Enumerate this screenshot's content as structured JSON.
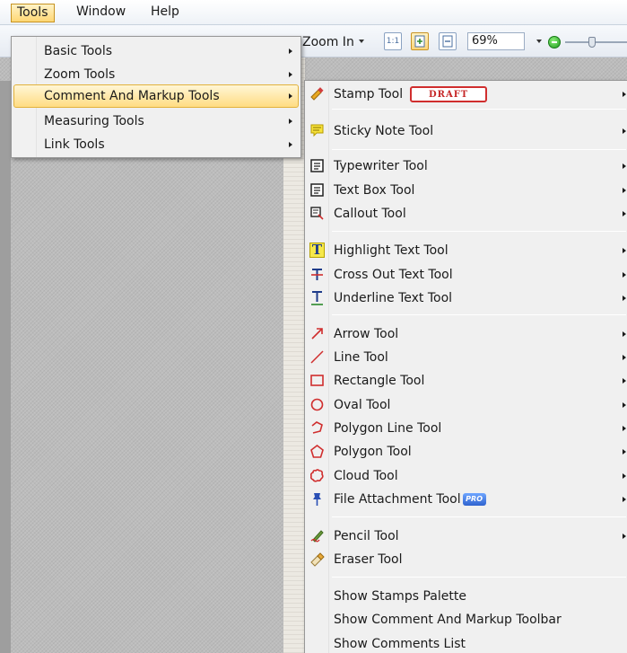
{
  "menubar": {
    "items": [
      {
        "label": "Tools",
        "active": true
      },
      {
        "label": "Window",
        "active": false
      },
      {
        "label": "Help",
        "active": false
      }
    ]
  },
  "toolbar": {
    "zoom_in_label": "Zoom In",
    "zoom_value": "69%",
    "actual_size_label": "1:1"
  },
  "tools_menu": {
    "items": [
      {
        "label": "Basic Tools",
        "highlighted": false
      },
      {
        "label": "Zoom Tools",
        "highlighted": false
      },
      {
        "label": "Comment And Markup Tools",
        "highlighted": true
      },
      {
        "label": "Measuring Tools",
        "highlighted": false
      },
      {
        "label": "Link Tools",
        "highlighted": false
      }
    ]
  },
  "markup_menu": {
    "items": [
      {
        "label": "Stamp Tool",
        "icon": "stamp-icon",
        "submenu": true
      },
      {
        "label": "Sticky Note Tool",
        "icon": "sticky-note-icon",
        "submenu": true
      },
      {
        "label": "Typewriter Tool",
        "icon": "typewriter-icon",
        "submenu": true
      },
      {
        "label": "Text Box Tool",
        "icon": "text-box-icon",
        "submenu": true
      },
      {
        "label": "Callout Tool",
        "icon": "callout-icon",
        "submenu": true
      },
      {
        "label": "Highlight Text Tool",
        "icon": "highlight-text-icon",
        "submenu": true
      },
      {
        "label": "Cross Out Text Tool",
        "icon": "cross-out-text-icon",
        "submenu": true
      },
      {
        "label": "Underline Text Tool",
        "icon": "underline-text-icon",
        "submenu": true
      },
      {
        "label": "Arrow Tool",
        "icon": "arrow-icon",
        "submenu": true
      },
      {
        "label": "Line Tool",
        "icon": "line-icon",
        "submenu": true
      },
      {
        "label": "Rectangle Tool",
        "icon": "rectangle-icon",
        "submenu": true
      },
      {
        "label": "Oval Tool",
        "icon": "oval-icon",
        "submenu": true
      },
      {
        "label": "Polygon Line Tool",
        "icon": "polygon-line-icon",
        "submenu": true
      },
      {
        "label": "Polygon Tool",
        "icon": "polygon-icon",
        "submenu": true
      },
      {
        "label": "Cloud Tool",
        "icon": "cloud-icon",
        "submenu": true
      },
      {
        "label": "File Attachment Tool",
        "icon": "file-attachment-icon",
        "submenu": true
      },
      {
        "label": "Pencil Tool",
        "icon": "pencil-icon",
        "submenu": true
      },
      {
        "label": "Eraser Tool",
        "icon": "eraser-icon",
        "submenu": false
      },
      {
        "label": "Show Stamps Palette",
        "icon": "",
        "submenu": false
      },
      {
        "label": "Show Comment And Markup Toolbar",
        "icon": "",
        "submenu": false
      },
      {
        "label": "Show Comments List",
        "icon": "",
        "submenu": false
      }
    ],
    "stamp_preview": "DRAFT",
    "pro_badge": "PRO"
  },
  "colors": {
    "highlight_bg": "#ffdc82",
    "highlight_border": "#e2b23c",
    "markup_red": "#d02e2e",
    "menu_bg": "#f0f0f0"
  }
}
